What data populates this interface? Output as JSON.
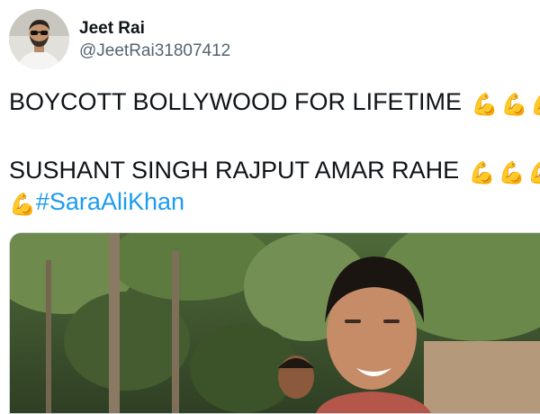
{
  "user": {
    "display_name": "Jeet Rai",
    "handle": "@JeetRai31807412"
  },
  "tweet": {
    "line1_text": "BOYCOTT BOLLYWOOD FOR LIFETIME",
    "line2_text": "SUSHANT SINGH RAJPUT AMAR RAHE",
    "hashtag": "#SaraAliKhan",
    "emoji": "💪"
  },
  "icons": {
    "emoji_name": "flexed-biceps-icon"
  }
}
